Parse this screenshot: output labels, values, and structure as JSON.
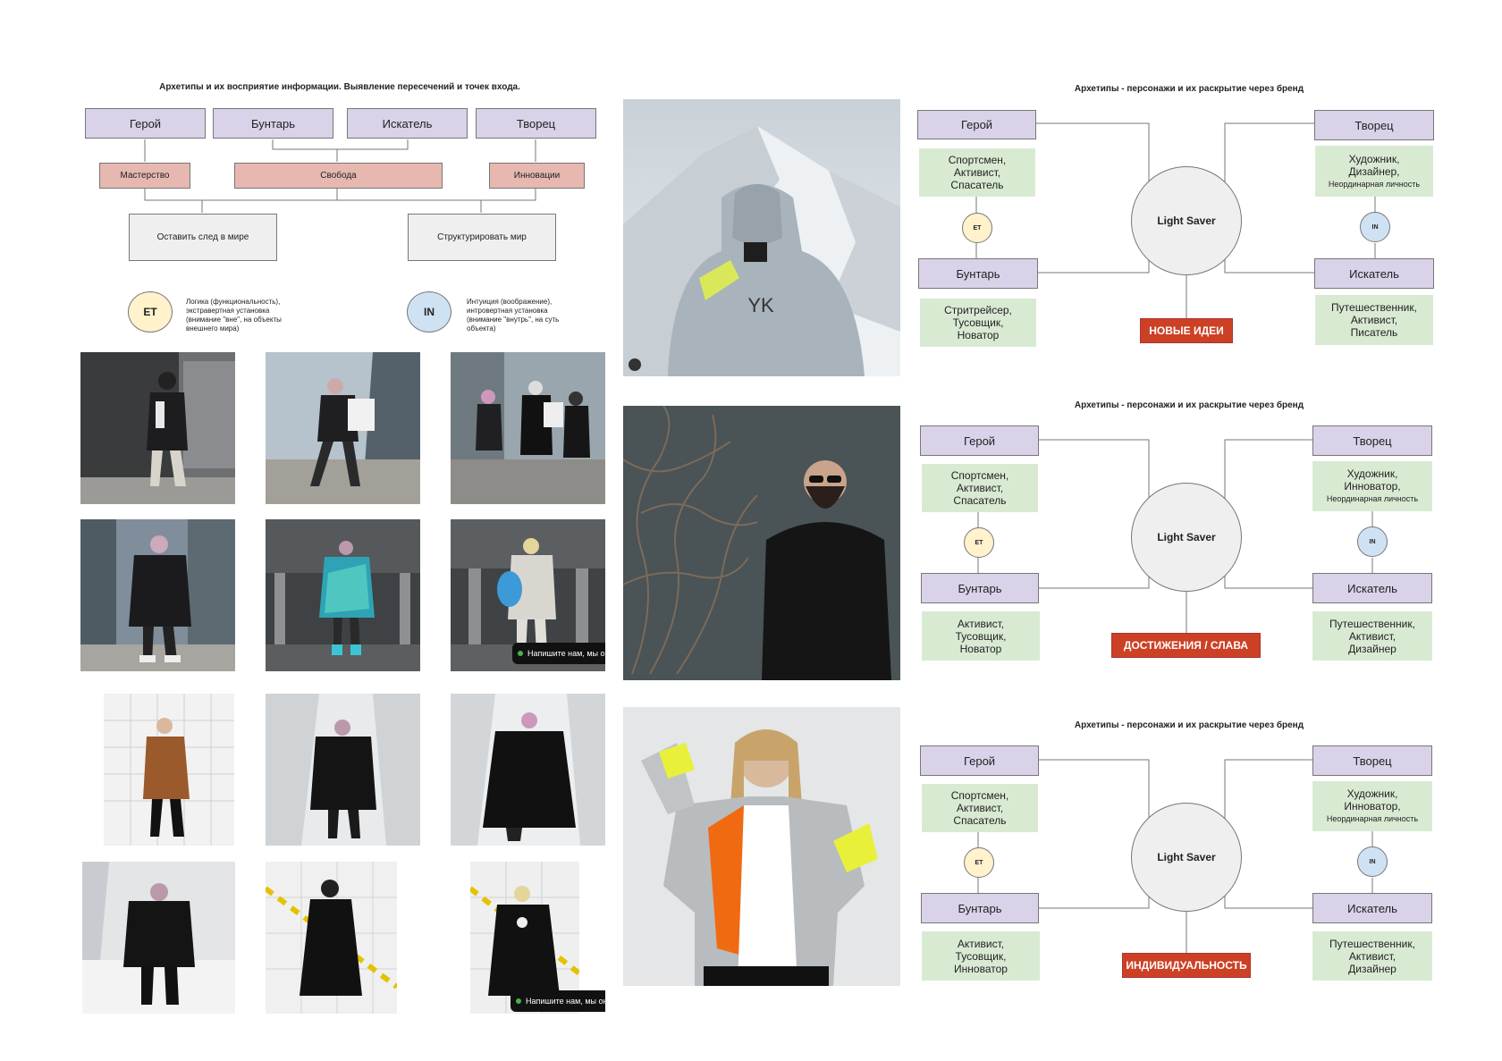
{
  "left": {
    "title": "Архетипы и их восприятие информации. Выявление пересечений и точек входа.",
    "archetypes": [
      "Герой",
      "Бунтарь",
      "Искатель",
      "Творец"
    ],
    "values": [
      "Мастерство",
      "Свобода",
      "Инновации"
    ],
    "goals": [
      "Оставить след в мире",
      "Структурировать мир"
    ],
    "et": {
      "label": "ET",
      "text": "Логика (функциональность), экстравертная установка (внимание \"вне\", на объекты внешнего мира)"
    },
    "in": {
      "label": "IN",
      "text": "Интуиция (воображение), интровертная установка (внимание \"внутрь\", на суть объекта)"
    }
  },
  "chat_label": "Напишите нам, мы он",
  "diagrams": [
    {
      "title": "Архетипы - персонажи и их раскрытие через бренд",
      "hero": "Герой",
      "hero_roles": "Спортсмен,\nАктивист,\nСпасатель",
      "rebel": "Бунтарь",
      "rebel_roles": "Стритрейсер,\nТусовщик,\nНоватор",
      "creator": "Творец",
      "creator_roles": "Художник,\nДизайнер,",
      "creator_extra": "Неординарная личность",
      "seeker": "Искатель",
      "seeker_roles": "Путешественник,\nАктивист,\nПисатель",
      "core": "Light Saver",
      "et": "ET",
      "in": "IN",
      "label": "НОВЫЕ ИДЕИ"
    },
    {
      "title": "Архетипы - персонажи и их раскрытие через бренд",
      "hero": "Герой",
      "hero_roles": "Спортсмен,\nАктивист,\nСпасатель",
      "rebel": "Бунтарь",
      "rebel_roles": "Активист,\nТусовщик,\nНоватор",
      "creator": "Творец",
      "creator_roles": "Художник,\nИнноватор,",
      "creator_extra": "Неординарная личность",
      "seeker": "Искатель",
      "seeker_roles": "Путешественник,\nАктивист,\nДизайнер",
      "core": "Light Saver",
      "et": "ET",
      "in": "IN",
      "label": "ДОСТИЖЕНИЯ / СЛАВА"
    },
    {
      "title": "Архетипы - персонажи и их раскрытие через бренд",
      "hero": "Герой",
      "hero_roles": "Спортсмен,\nАктивист,\nСпасатель",
      "rebel": "Бунтарь",
      "rebel_roles": "Активист,\nТусовщик,\nИнноватор",
      "creator": "Творец",
      "creator_roles": "Художник,\nИнноватор,",
      "creator_extra": "Неординарная личность",
      "seeker": "Искатель",
      "seeker_roles": "Путешественник,\nАктивист,\nДизайнер",
      "core": "Light Saver",
      "et": "ET",
      "in": "IN",
      "label": "ИНДИВИДУАЛЬНОСТЬ"
    }
  ],
  "jacket_logo": "YK"
}
